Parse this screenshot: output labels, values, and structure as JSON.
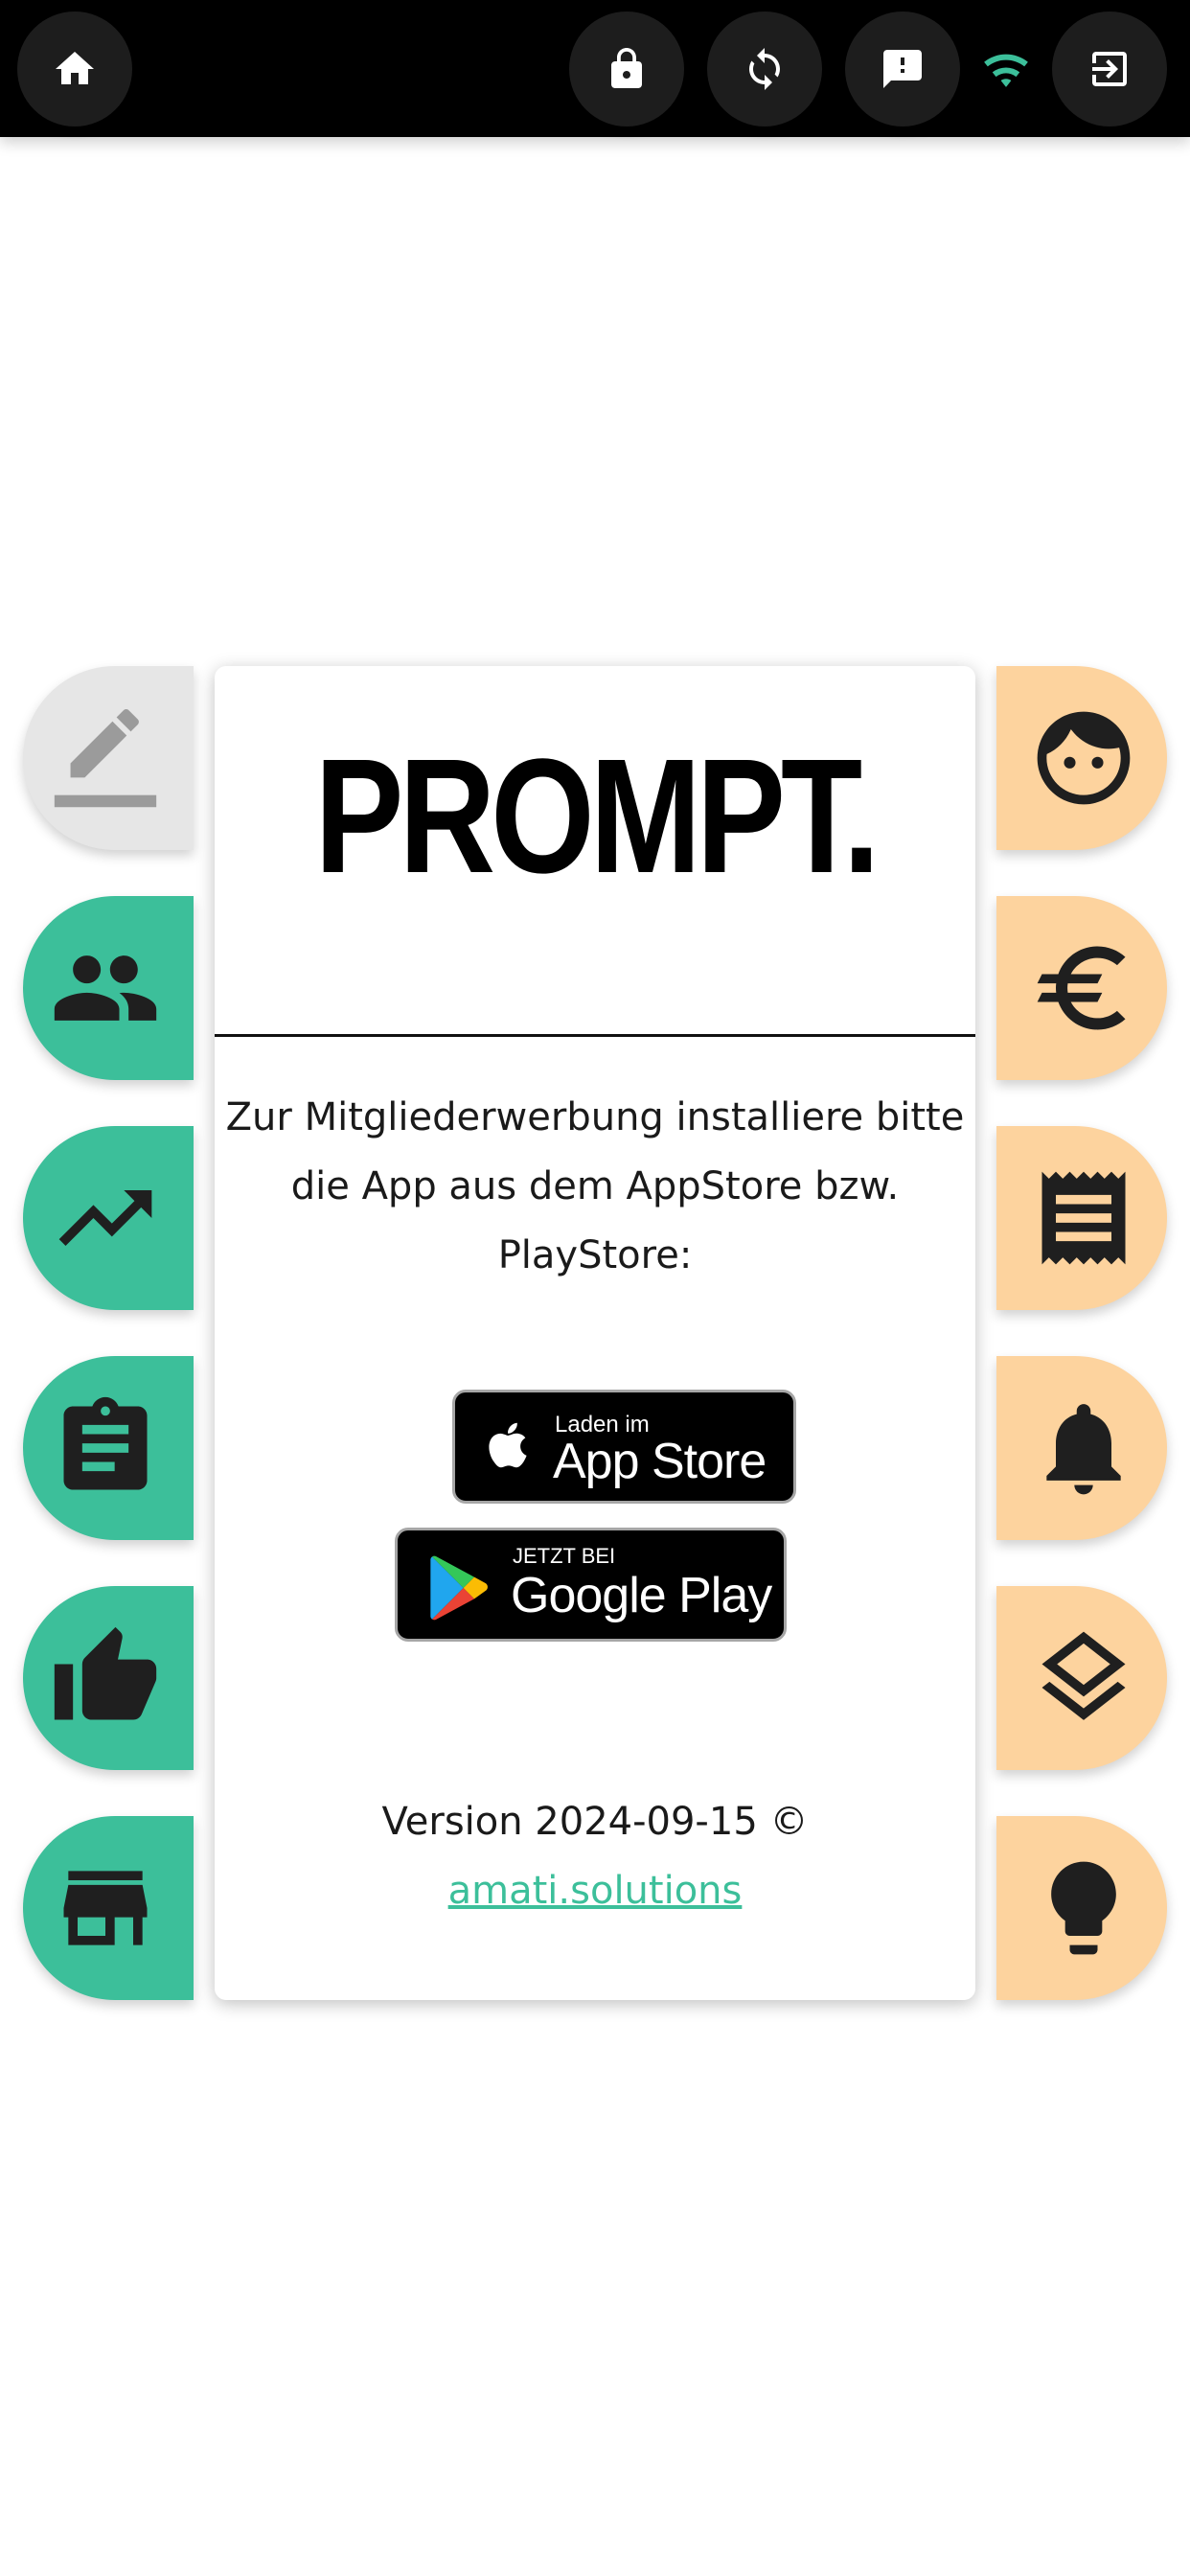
{
  "topbar": {
    "icons": [
      "home-icon",
      "lock-icon",
      "sync-icon",
      "feedback-icon",
      "wifi-icon",
      "logout-icon"
    ],
    "wifi_color": "#3cbf9a"
  },
  "left_tabs": [
    {
      "icon": "edit-icon",
      "color": "#e6e6e6"
    },
    {
      "icon": "people-icon",
      "color": "#3cbf9a"
    },
    {
      "icon": "trending-icon",
      "color": "#3cbf9a"
    },
    {
      "icon": "clipboard-icon",
      "color": "#3cbf9a"
    },
    {
      "icon": "thumb-up-icon",
      "color": "#3cbf9a"
    },
    {
      "icon": "store-icon",
      "color": "#3cbf9a"
    }
  ],
  "right_tabs": [
    {
      "icon": "face-icon",
      "color": "#fdd39e"
    },
    {
      "icon": "euro-icon",
      "color": "#fdd39e"
    },
    {
      "icon": "receipt-icon",
      "color": "#fdd39e"
    },
    {
      "icon": "bell-icon",
      "color": "#fdd39e"
    },
    {
      "icon": "layers-icon",
      "color": "#fdd39e"
    },
    {
      "icon": "lightbulb-icon",
      "color": "#fdd39e"
    }
  ],
  "card": {
    "logo": "PROMPT.",
    "intro_line1": "Zur Mitgliederwerbung installiere bitte",
    "intro_line2": "die App aus dem AppStore bzw.",
    "intro_line3": "PlayStore:",
    "appstore_small": "Laden im",
    "appstore_big": "App Store",
    "googleplay_small": "JETZT BEI",
    "googleplay_big": "Google Play",
    "version": "Version 2024-09-15 ©",
    "link": "amati.solutions"
  }
}
